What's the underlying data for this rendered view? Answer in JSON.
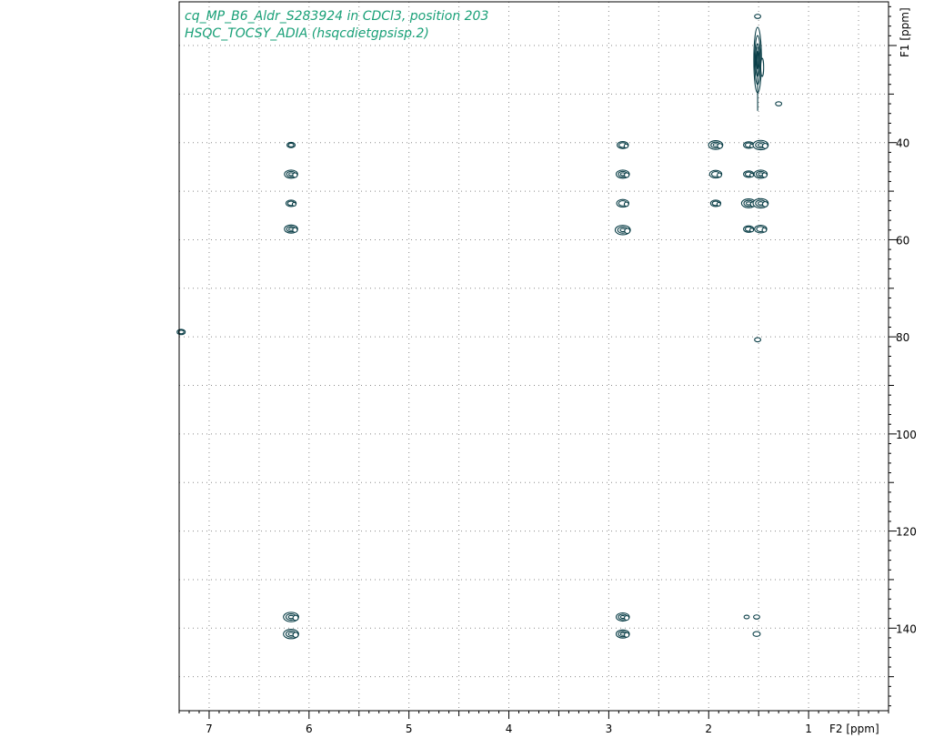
{
  "title": {
    "line1": "cq_MP_B6_Aldr_S283924 in CDCl3, position 203",
    "line2": "HSQC_TOCSY_ADIA (hsqcdietgpsisp.2)"
  },
  "axes": {
    "x_label": "F2 [ppm]",
    "y_label": "F1 [ppm]",
    "x_tick_labels": [
      "7",
      "6",
      "5",
      "4",
      "3",
      "2",
      "1"
    ],
    "y_tick_labels": [
      "40",
      "60",
      "80",
      "100",
      "120",
      "140"
    ]
  },
  "colors": {
    "contour": "#0b3f48",
    "title": "#1aa078",
    "grid": "#8a8a8a"
  },
  "chart_data": {
    "type": "scatter",
    "subtype": "2D NMR contour plot",
    "title": "cq_MP_B6_Aldr_S283924 in CDCl3, position 203",
    "subtitle": "HSQC_TOCSY_ADIA (hsqcdietgpsisp.2)",
    "xlabel": "F2 [ppm]",
    "ylabel": "F1 [ppm]",
    "xlim": [
      7.3,
      0.2
    ],
    "ylim": [
      157,
      11
    ],
    "x_reversed": true,
    "y_reversed": true,
    "grid": true,
    "x_ticks": [
      7,
      6,
      5,
      4,
      3,
      2,
      1
    ],
    "y_ticks": [
      40,
      60,
      80,
      100,
      120,
      140
    ],
    "peaks": [
      {
        "x": 6.18,
        "y": 40.5,
        "size": 0.6
      },
      {
        "x": 6.18,
        "y": 46.5,
        "size": 1.1
      },
      {
        "x": 6.18,
        "y": 52.5,
        "size": 0.8
      },
      {
        "x": 6.18,
        "y": 57.8,
        "size": 1.1
      },
      {
        "x": 6.18,
        "y": 137.7,
        "size": 1.3
      },
      {
        "x": 6.18,
        "y": 141.2,
        "size": 1.3
      },
      {
        "x": 2.86,
        "y": 40.5,
        "size": 0.9
      },
      {
        "x": 2.86,
        "y": 46.5,
        "size": 1.1
      },
      {
        "x": 2.86,
        "y": 52.5,
        "size": 1.0
      },
      {
        "x": 2.86,
        "y": 58.0,
        "size": 1.3
      },
      {
        "x": 2.86,
        "y": 137.7,
        "size": 1.1
      },
      {
        "x": 2.86,
        "y": 141.2,
        "size": 1.1
      },
      {
        "x": 1.93,
        "y": 40.5,
        "size": 1.2
      },
      {
        "x": 1.93,
        "y": 46.5,
        "size": 1.0
      },
      {
        "x": 1.93,
        "y": 52.5,
        "size": 0.8
      },
      {
        "x": 1.6,
        "y": 40.5,
        "size": 0.8
      },
      {
        "x": 1.6,
        "y": 46.5,
        "size": 0.8
      },
      {
        "x": 1.6,
        "y": 52.5,
        "size": 1.2
      },
      {
        "x": 1.6,
        "y": 57.8,
        "size": 0.8
      },
      {
        "x": 1.48,
        "y": 40.5,
        "size": 1.3
      },
      {
        "x": 1.48,
        "y": 46.5,
        "size": 1.1
      },
      {
        "x": 1.48,
        "y": 52.5,
        "size": 1.3
      },
      {
        "x": 1.48,
        "y": 57.8,
        "size": 1.0
      },
      {
        "x": 1.51,
        "y": 23.0,
        "size": 0.9,
        "elongated": true
      },
      {
        "x": 1.51,
        "y": 14.0,
        "size": 0.4
      },
      {
        "x": 1.3,
        "y": 32.0,
        "size": 0.4
      },
      {
        "x": 1.51,
        "y": 80.6,
        "size": 0.4
      },
      {
        "x": 1.52,
        "y": 137.7,
        "size": 0.4
      },
      {
        "x": 1.52,
        "y": 141.2,
        "size": 0.5
      },
      {
        "x": 1.62,
        "y": 137.7,
        "size": 0.3
      },
      {
        "x": 7.28,
        "y": 79.0,
        "size": 0.6
      }
    ]
  }
}
